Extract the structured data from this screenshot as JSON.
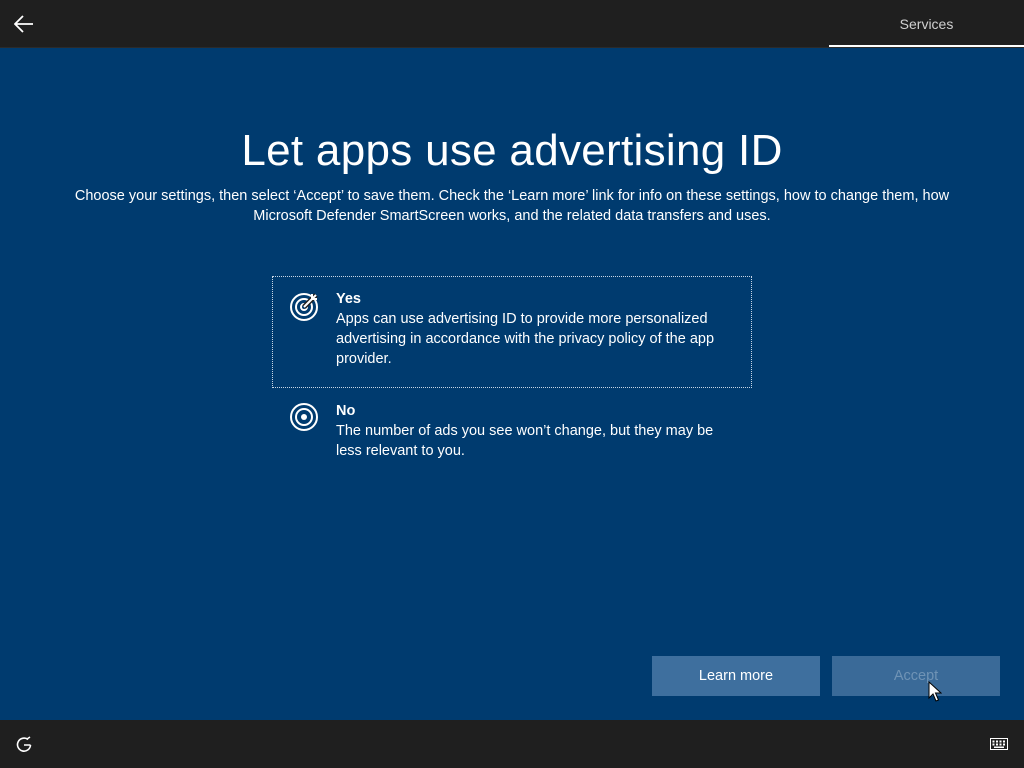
{
  "header": {
    "back_icon": "arrow-left-icon",
    "tab_label": "Services"
  },
  "main": {
    "title": "Let apps use advertising ID",
    "subtitle": "Choose your settings, then select ‘Accept’ to save them. Check the ‘Learn more’ link for info on these settings, how to change them, how Microsoft Defender SmartScreen works, and the related data transfers and uses.",
    "options": [
      {
        "icon": "target-with-arrow-icon",
        "title": "Yes",
        "description": "Apps can use advertising ID to provide more personalized advertising in accordance with the privacy policy of the app provider.",
        "selected": true
      },
      {
        "icon": "target-icon",
        "title": "No",
        "description": "The number of ads you see won’t change, but they may be less relevant to you.",
        "selected": false
      }
    ]
  },
  "buttons": {
    "learn_more": "Learn more",
    "accept": "Accept"
  },
  "footer": {
    "left_icon": "accessibility-icon",
    "right_icon": "keyboard-icon"
  },
  "colors": {
    "background": "#003b6f",
    "bar": "#1f1f1f",
    "button": "#3e6f9e",
    "text": "#ffffff"
  }
}
